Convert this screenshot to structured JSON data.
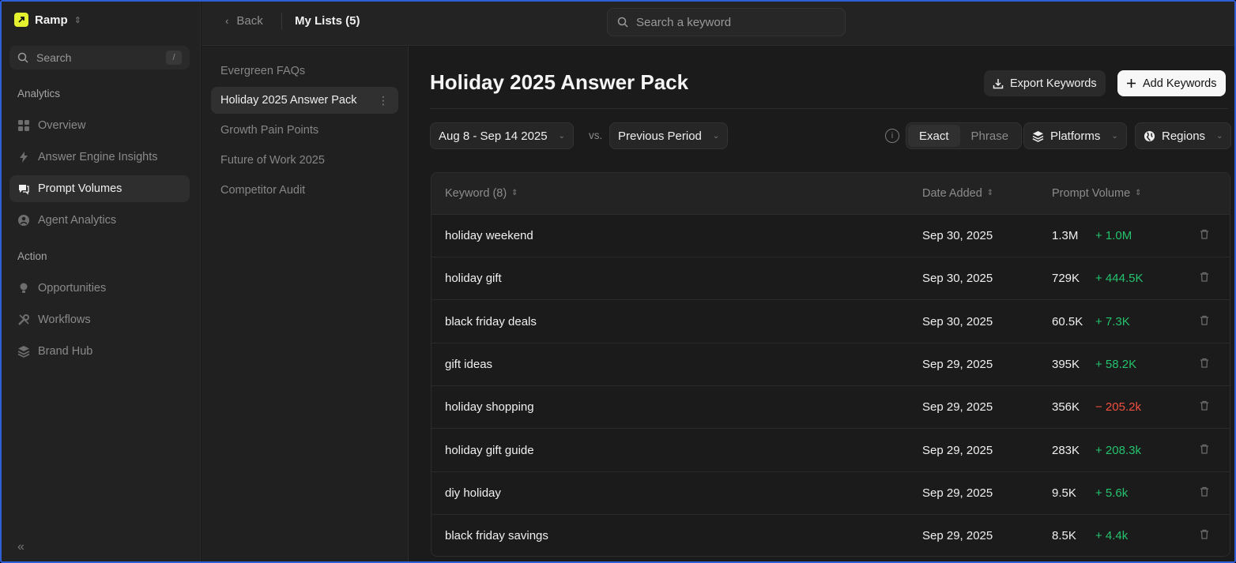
{
  "sidebar": {
    "brand": "Ramp",
    "search_label": "Search",
    "search_shortcut": "/",
    "sections": {
      "analytics": "Analytics",
      "action": "Action"
    },
    "items": [
      {
        "label": "Overview",
        "icon": "grid-icon"
      },
      {
        "label": "Answer Engine Insights",
        "icon": "bolt-icon"
      },
      {
        "label": "Prompt Volumes",
        "icon": "chat-icon",
        "active": true
      },
      {
        "label": "Agent Analytics",
        "icon": "agent-icon"
      },
      {
        "label": "Opportunities",
        "icon": "bulb-icon"
      },
      {
        "label": "Workflows",
        "icon": "tools-icon"
      },
      {
        "label": "Brand Hub",
        "icon": "stack-icon"
      }
    ],
    "collapse_glyph": "«"
  },
  "topbar": {
    "back_label": "Back",
    "breadcrumb": "My Lists (5)",
    "search_placeholder": "Search a keyword"
  },
  "lists": [
    {
      "label": "Evergreen FAQs"
    },
    {
      "label": "Holiday 2025 Answer Pack",
      "active": true
    },
    {
      "label": "Growth Pain Points"
    },
    {
      "label": "Future of Work 2025"
    },
    {
      "label": "Competitor Audit"
    }
  ],
  "main": {
    "title": "Holiday 2025 Answer Pack",
    "export_label": "Export Keywords",
    "add_label": "Add Keywords",
    "date_range": "Aug 8 - Sep 14 2025",
    "vs_label": "vs.",
    "compare_period": "Previous Period",
    "match_exact": "Exact",
    "match_phrase": "Phrase",
    "platforms_label": "Platforms",
    "regions_label": "Regions"
  },
  "table": {
    "columns": [
      "Keyword (8)",
      "Date Added",
      "Prompt Volume"
    ],
    "rows": [
      {
        "keyword": "holiday weekend",
        "date": "Sep 30, 2025",
        "volume": "1.3M",
        "delta": "+ 1.0M",
        "trend": "up"
      },
      {
        "keyword": "holiday gift",
        "date": "Sep 30, 2025",
        "volume": "729K",
        "delta": "+ 444.5K",
        "trend": "up"
      },
      {
        "keyword": "black friday deals",
        "date": "Sep 30, 2025",
        "volume": "60.5K",
        "delta": "+ 7.3K",
        "trend": "up"
      },
      {
        "keyword": "gift ideas",
        "date": "Sep 29, 2025",
        "volume": "395K",
        "delta": "+ 58.2K",
        "trend": "up"
      },
      {
        "keyword": "holiday shopping",
        "date": "Sep 29, 2025",
        "volume": "356K",
        "delta": "− 205.2k",
        "trend": "down"
      },
      {
        "keyword": "holiday gift guide",
        "date": "Sep 29, 2025",
        "volume": "283K",
        "delta": "+ 208.3k",
        "trend": "up"
      },
      {
        "keyword": "diy holiday",
        "date": "Sep 29, 2025",
        "volume": "9.5K",
        "delta": "+ 5.6k",
        "trend": "up"
      },
      {
        "keyword": "black friday savings",
        "date": "Sep 29, 2025",
        "volume": "8.5K",
        "delta": "+ 4.4k",
        "trend": "up"
      }
    ]
  },
  "colors": {
    "accent_brand": "#e4f12e",
    "positive": "#25c26d",
    "negative": "#f0503f",
    "frame_border": "#2f5fd6"
  }
}
